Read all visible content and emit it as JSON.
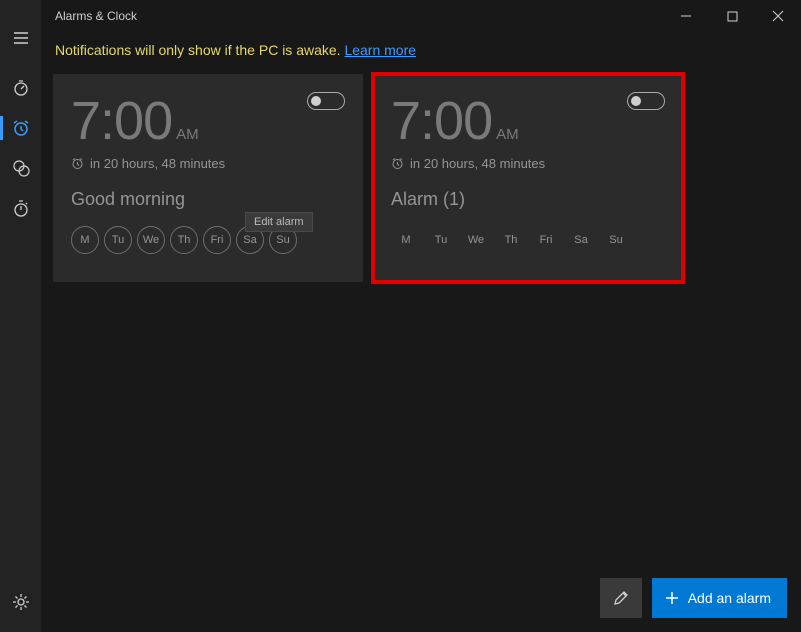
{
  "titlebar": {
    "title": "Alarms & Clock"
  },
  "notice": {
    "text": "Notifications will only show if the PC is awake. ",
    "link": "Learn more"
  },
  "tooltip": "Edit alarm",
  "sidebar": {
    "items": [
      "menu",
      "timer",
      "alarm",
      "world-clock",
      "stopwatch"
    ],
    "active": 2,
    "bottom": "settings"
  },
  "alarms": [
    {
      "time": "7:00",
      "ampm": "AM",
      "next": "in 20 hours, 48 minutes",
      "name": "Good morning",
      "days": [
        "M",
        "Tu",
        "We",
        "Th",
        "Fri",
        "Sa",
        "Su"
      ],
      "days_style": "circled",
      "enabled": false,
      "highlighted": false
    },
    {
      "time": "7:00",
      "ampm": "AM",
      "next": "in 20 hours, 48 minutes",
      "name": "Alarm (1)",
      "days": [
        "M",
        "Tu",
        "We",
        "Th",
        "Fri",
        "Sa",
        "Su"
      ],
      "days_style": "plain",
      "enabled": false,
      "highlighted": true
    }
  ],
  "actions": {
    "edit": "Edit",
    "add": "Add an alarm"
  }
}
